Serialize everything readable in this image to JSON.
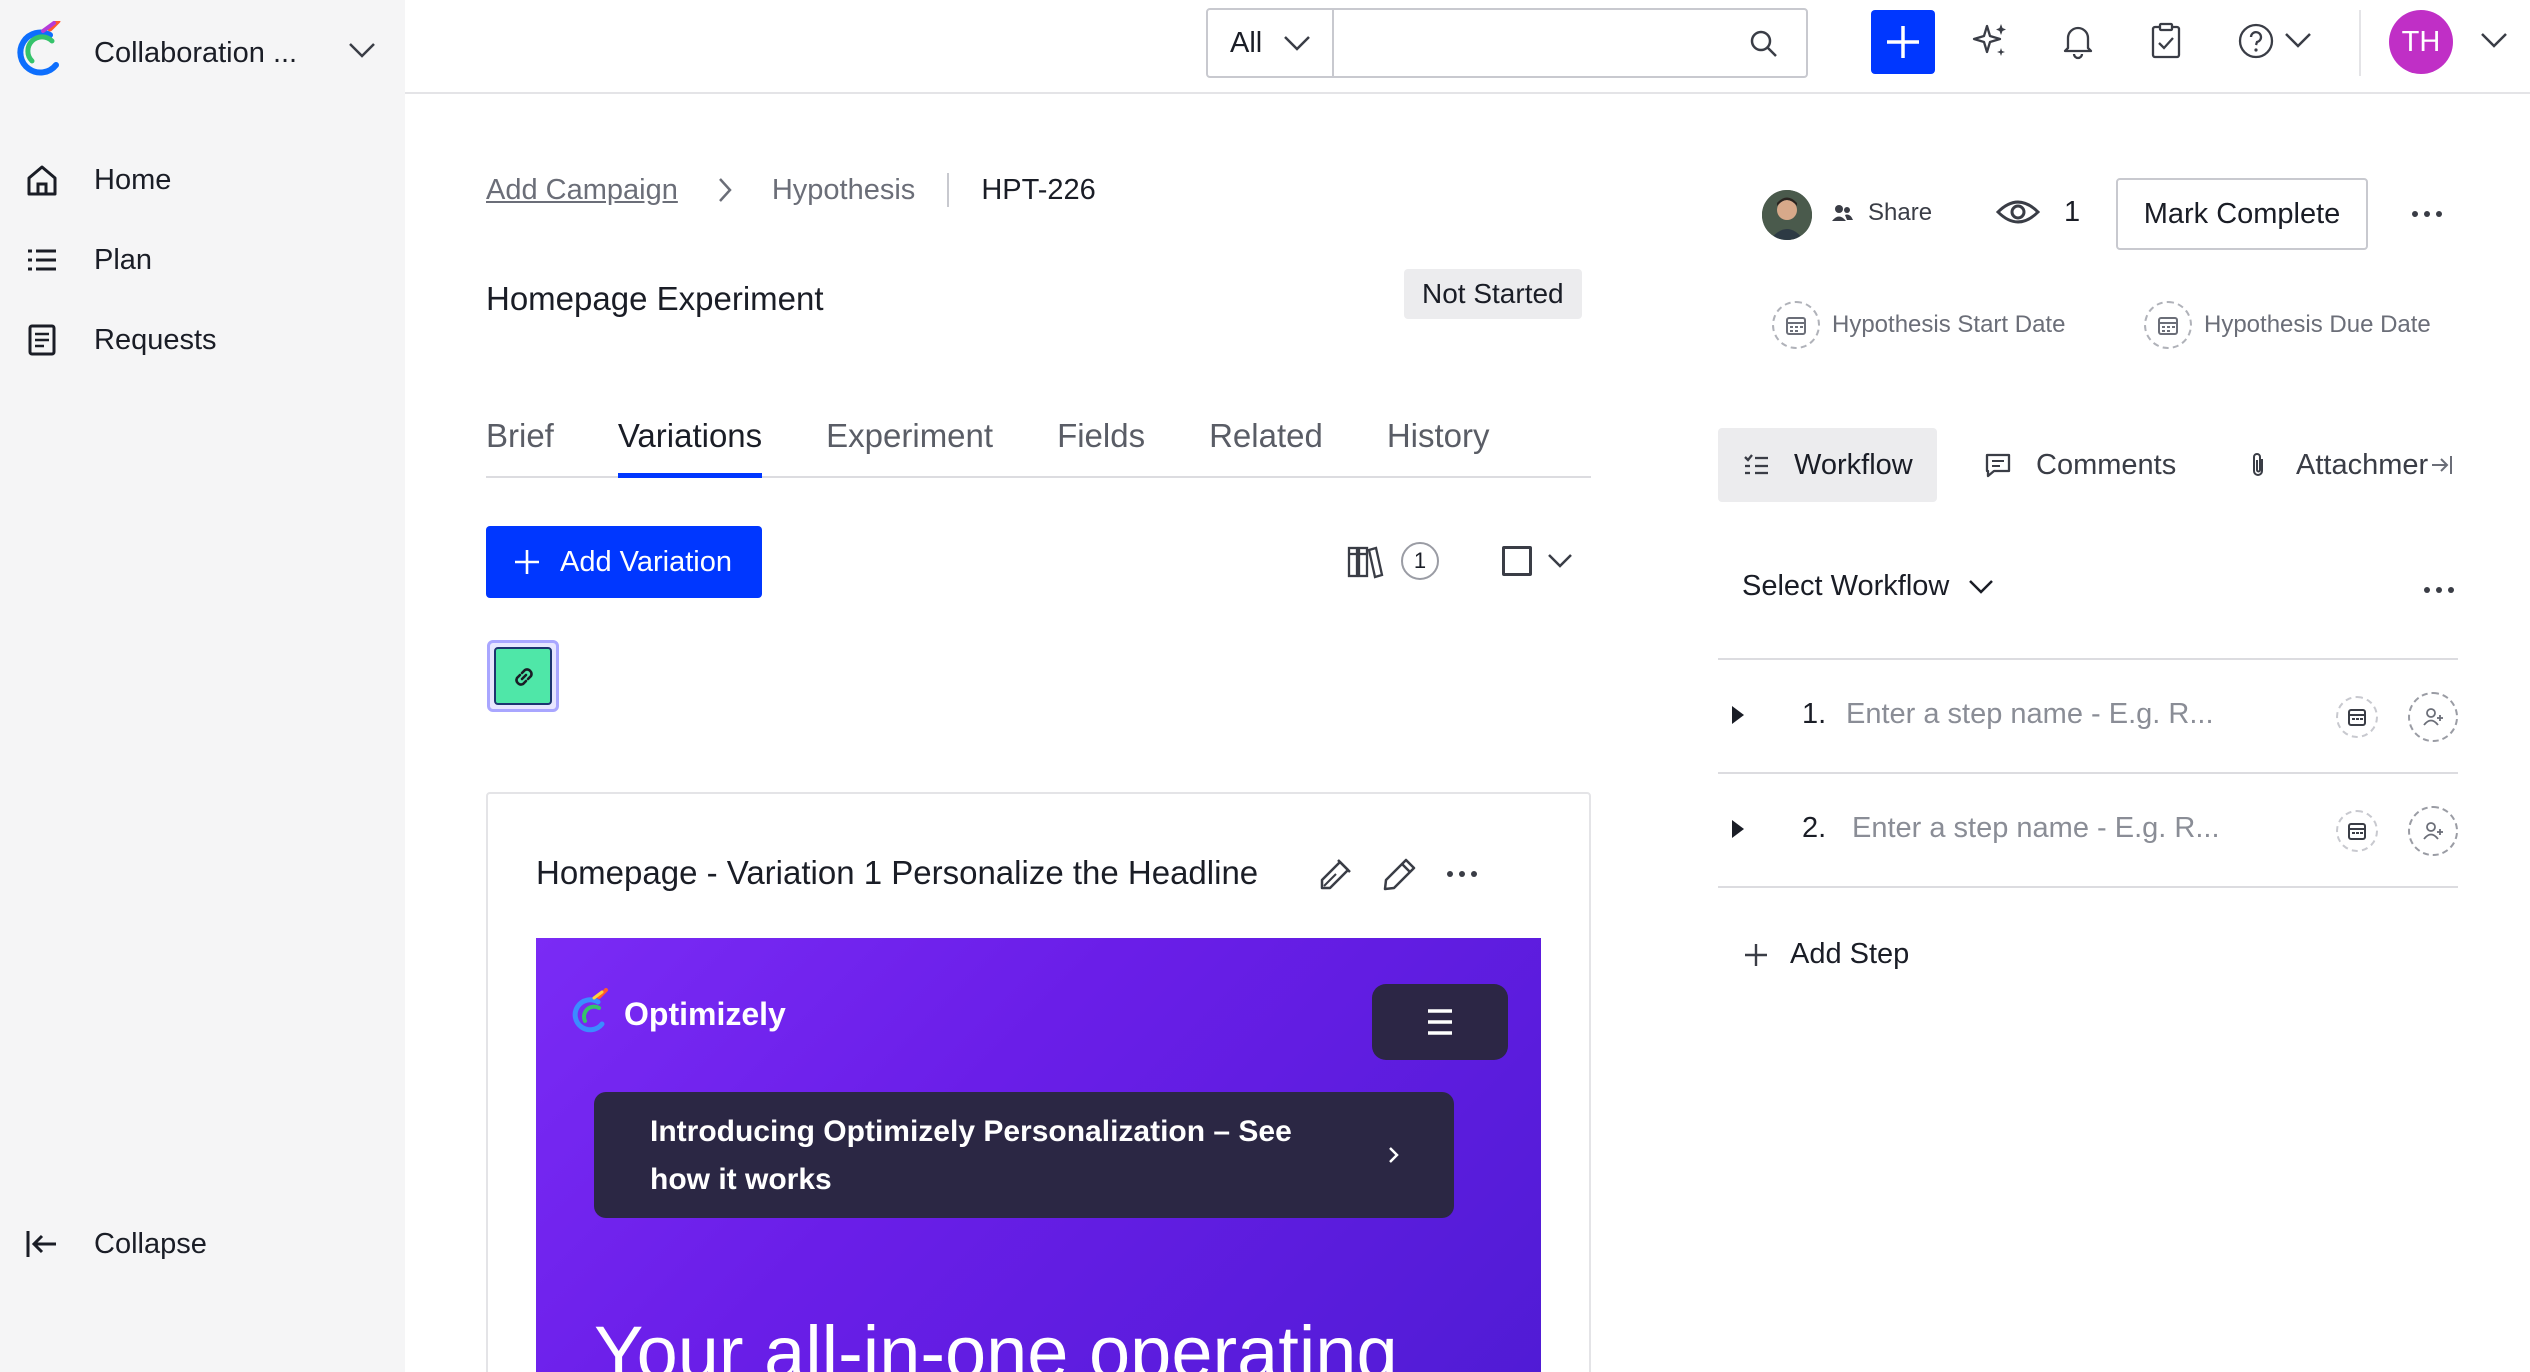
{
  "sidebar": {
    "workspace_name": "Collaboration ...",
    "nav": [
      {
        "label": "Home",
        "icon": "home-icon"
      },
      {
        "label": "Plan",
        "icon": "list-icon"
      },
      {
        "label": "Requests",
        "icon": "document-icon"
      }
    ],
    "collapse_label": "Collapse"
  },
  "topbar": {
    "scope_label": "All",
    "search_placeholder": "",
    "avatar_initials": "TH",
    "accent": "#0037ff",
    "avatar_color": "#c02fc6"
  },
  "breadcrumb": {
    "root": "Add Campaign",
    "type": "Hypothesis",
    "id": "HPT-226"
  },
  "page": {
    "title": "Homepage Experiment",
    "status": "Not Started",
    "tabs": [
      "Brief",
      "Variations",
      "Experiment",
      "Fields",
      "Related",
      "History"
    ],
    "active_tab": "Variations"
  },
  "variations": {
    "add_label": "Add Variation",
    "library_count": "1",
    "card": {
      "title": "Homepage - Variation 1 Personalize the Headline",
      "preview": {
        "brand": "Optimizely",
        "banner": "Introducing Optimizely Personalization – See how it works",
        "hero": "Your all-in-one operating"
      }
    }
  },
  "right_panel": {
    "share_label": "Share",
    "watchers": "1",
    "mark_complete_label": "Mark Complete",
    "start_date_label": "Hypothesis Start Date",
    "due_date_label": "Hypothesis Due Date",
    "tabs": [
      "Workflow",
      "Comments",
      "Attachmer"
    ],
    "select_workflow_label": "Select Workflow",
    "steps": [
      {
        "num": "1.",
        "placeholder": "Enter a step name - E.g. R..."
      },
      {
        "num": "2.",
        "placeholder": "Enter a step name - E.g. R..."
      }
    ],
    "add_step_label": "Add Step"
  }
}
